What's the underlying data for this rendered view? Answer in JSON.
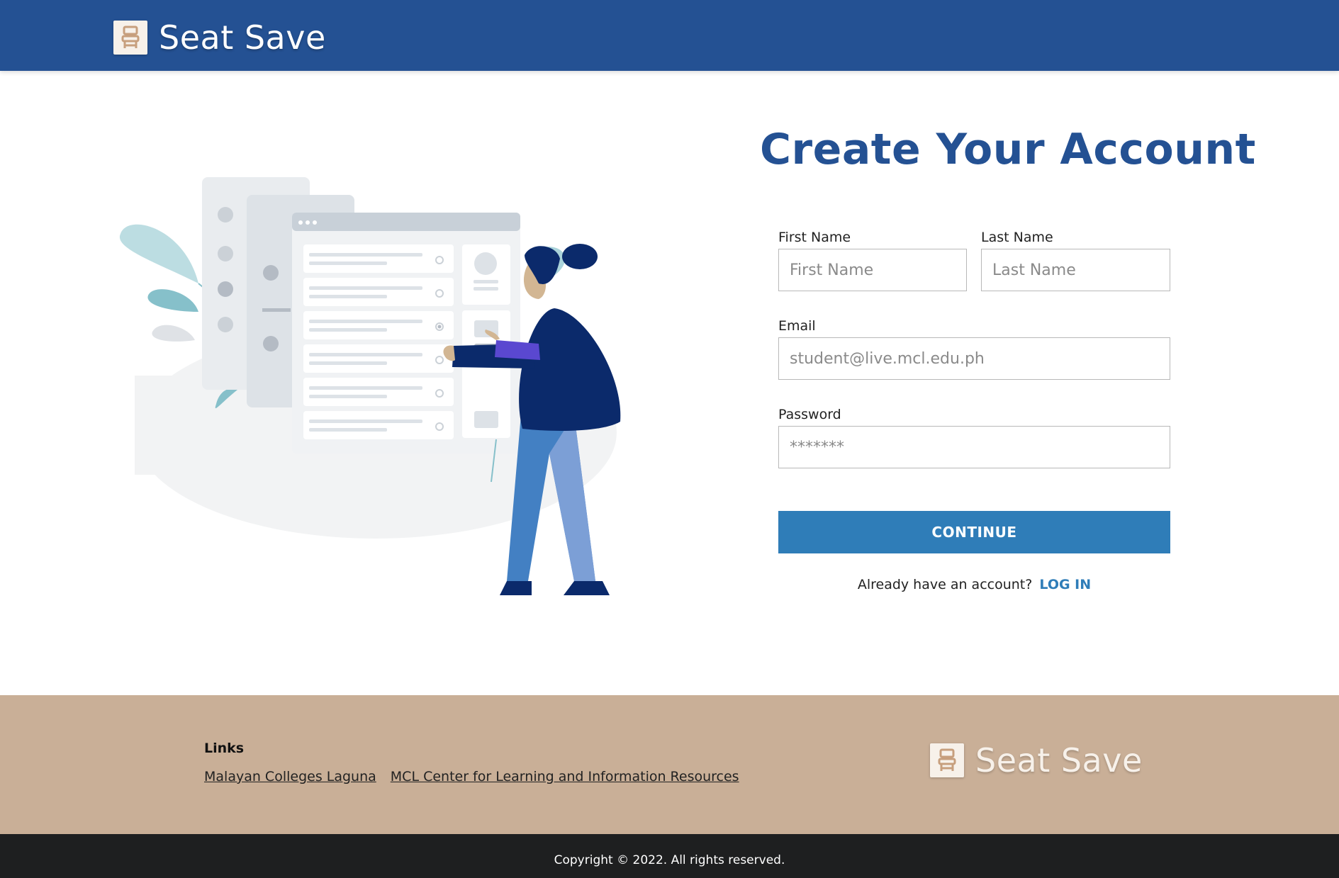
{
  "header": {
    "brand_name": "Seat Save",
    "logo_icon": "seat-icon",
    "background_color": "#245193"
  },
  "form": {
    "title": "Create Your Account",
    "first_name": {
      "label": "First Name",
      "placeholder": "First Name",
      "value": ""
    },
    "last_name": {
      "label": "Last Name",
      "placeholder": "Last Name",
      "value": ""
    },
    "email": {
      "label": "Email",
      "placeholder": "student@live.mcl.edu.ph",
      "value": ""
    },
    "password": {
      "label": "Password",
      "placeholder": "*******",
      "value": ""
    },
    "continue_label": "CONTINUE",
    "login_prompt": "Already have an account?",
    "login_link": "LOG IN",
    "accent_color": "#2f7db8",
    "title_color": "#245193"
  },
  "footer": {
    "links_title": "Links",
    "links": [
      {
        "label": "Malayan Colleges Laguna"
      },
      {
        "label": "MCL Center for Learning and Information Resources"
      }
    ],
    "brand_name": "Seat Save",
    "background_color": "#c9af97",
    "copyright": "Copyright © 2022. All rights reserved."
  }
}
